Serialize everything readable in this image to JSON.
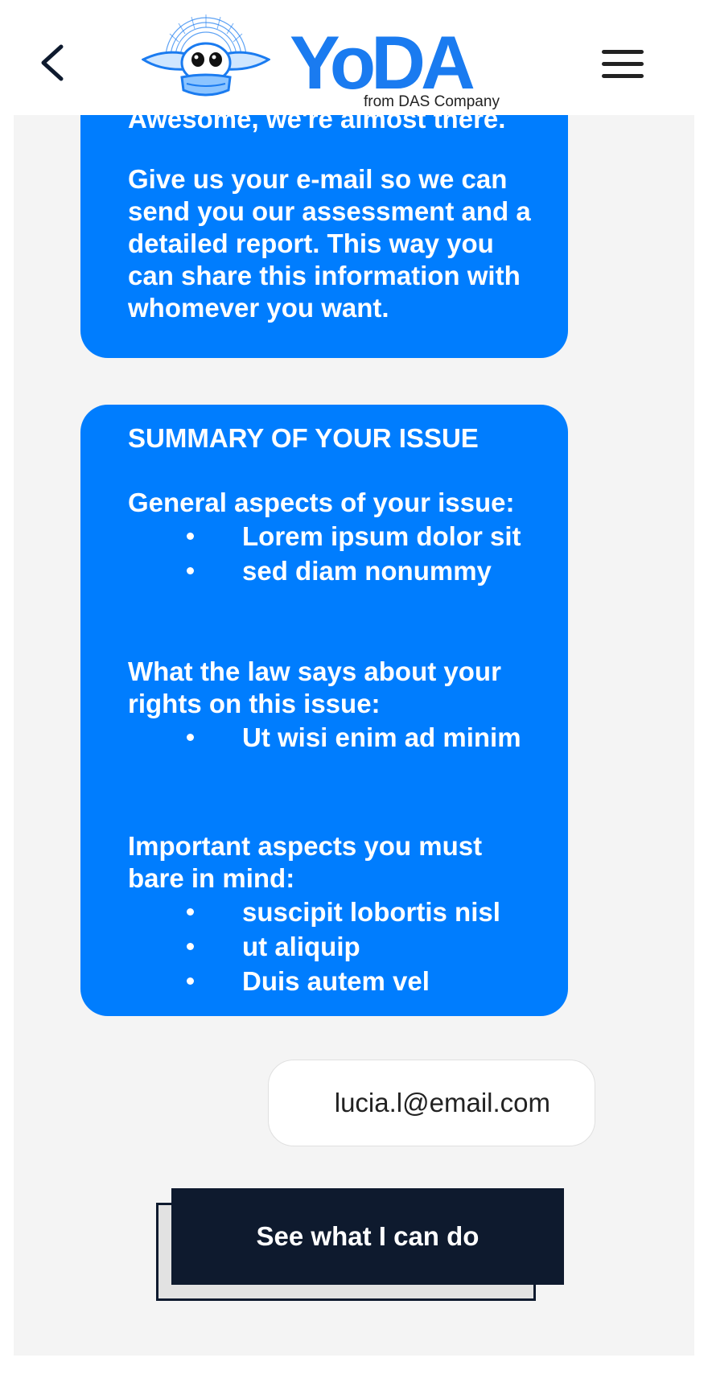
{
  "header": {
    "logo_text": "YoDA",
    "tagline": "from DAS Company",
    "back_icon": "chevron-left-icon",
    "menu_icon": "hamburger-menu-icon"
  },
  "colors": {
    "brand_blue": "#007dfe",
    "dark_navy": "#0e1a2e",
    "background": "#f4f4f4"
  },
  "bubble1": {
    "greeting": "Awesome, we're almost there.",
    "message": "Give us your e-mail so we can send you our assessment and a detailed report. This way you can share this information with whomever you want."
  },
  "summary": {
    "title": "SUMMARY OF YOUR ISSUE",
    "sections": [
      {
        "title": "General aspects of your issue:",
        "items": [
          "Lorem ipsum dolor sit",
          "sed diam nonummy"
        ]
      },
      {
        "title": "What the law says about your rights on this issue:",
        "items": [
          "Ut wisi enim ad minim"
        ]
      },
      {
        "title": "Important aspects you must bare in mind:",
        "items": [
          "suscipit lobortis nisl",
          "ut aliquip",
          "Duis autem vel"
        ]
      }
    ]
  },
  "reply": {
    "email": "lucia.l@email.com"
  },
  "cta": {
    "label": "See what I can do"
  }
}
